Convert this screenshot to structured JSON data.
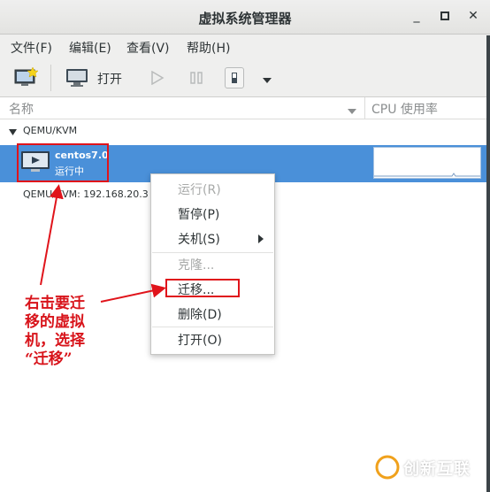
{
  "window": {
    "title": "虚拟系统管理器"
  },
  "menubar": [
    "文件(F)",
    "编辑(E)",
    "查看(V)",
    "帮助(H)"
  ],
  "toolbar": {
    "open_label": "打开"
  },
  "columns": {
    "name": "名称",
    "cpu": "CPU 使用率"
  },
  "tree": {
    "group": "QEMU/KVM",
    "vm": {
      "name": "centos7.0",
      "state": "运行中"
    },
    "remote_connection": "QEMU/KVM: 192.168.20.3"
  },
  "context_menu": {
    "run": "运行(R)",
    "pause": "暂停(P)",
    "shutdown": "关机(S)",
    "clone": "克隆...",
    "migrate": "迁移...",
    "delete": "删除(D)",
    "open": "打开(O)"
  },
  "annotation": {
    "line1": "右击要迁",
    "line2": "移的虚拟",
    "line3": "机，选择",
    "line4": "“迁移”"
  },
  "watermark": {
    "text": "创新互联"
  },
  "colors": {
    "selection": "#4a90d9",
    "annotation_red": "#e0141b"
  }
}
